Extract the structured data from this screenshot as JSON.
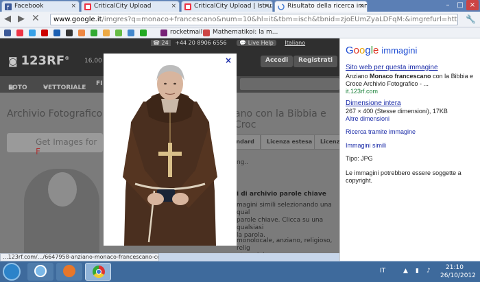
{
  "tabs": [
    {
      "label": "Facebook",
      "icon": "facebook-icon",
      "active": false
    },
    {
      "label": "CriticalCity Upload",
      "icon": "criticalcity-icon",
      "active": false
    },
    {
      "label": "CriticalCity Upload | Istruz",
      "icon": "criticalcity-icon",
      "active": false
    },
    {
      "label": "Risultato della ricerca imm",
      "icon": "google-icon",
      "active": true
    }
  ],
  "address": {
    "domain": "www.google.it",
    "path": "/imgres?q=monaco+francescano&num=10&hl=it&tbm=isch&tbnid=zjoEUmZyaLDFqM:&imgrefurl=http://it.123"
  },
  "bookmarks": [
    {
      "label": "rocketmail"
    },
    {
      "label": "Mathematikoi: la m..."
    }
  ],
  "site": {
    "phone": "+44 20 8906 6556",
    "live_help": "Live Help",
    "lang": "Italiano",
    "logo": "123RF",
    "logo_reg": "®",
    "count": "16,00",
    "login": "Accedi",
    "register": "Registrati",
    "nav": [
      "FOTO",
      "VETTORIALE",
      "FI"
    ],
    "title_left": "Archivio Fotografico",
    "title_right": "ano con la Bibbia e Croc",
    "get_images": "Get Images for ",
    "get_images_accent": "F",
    "lic_tabs": [
      "andard",
      "Licenza estesa",
      "Licenza"
    ],
    "dots": "ng..",
    "parole": "i di archivio parole chiave",
    "para": "magini simili selezionando una qual\nparole chiave. Clicca su una qualsiasi\nla parola.",
    "keywords": "monolocale, anziano, religioso, relig\nnto, grigio, croce, marrone, bibbia,"
  },
  "popup": {
    "close": "×"
  },
  "google": {
    "logo_letters": [
      "G",
      "o",
      "o",
      "g",
      "l",
      "e"
    ],
    "logo_suffix": "immagini",
    "site_link": "Sito web per questa immagine",
    "desc_pre": "Anziano ",
    "desc_bold": "Monaco francescano",
    "desc_post": " con la Bibbia e Croce Archivio Fotografico - ...",
    "domain": "it.123rf.com",
    "full_link": "Dimensione intera",
    "dims": "267 × 400 (Stesse dimensioni), 17KB",
    "other_dims": "Altre dimensioni",
    "search_by_image": "Ricerca tramite immagine",
    "similar": "Immagini simili",
    "type": "Tipo:  JPG",
    "copyright": "Le immagini potrebbero essere soggette a copyright."
  },
  "status": "...123rf.com/.../6647958-anziano-monaco-francescano-con-l...",
  "taskbar": {
    "lang": "IT",
    "time": "21:10",
    "date": "26/10/2012"
  }
}
